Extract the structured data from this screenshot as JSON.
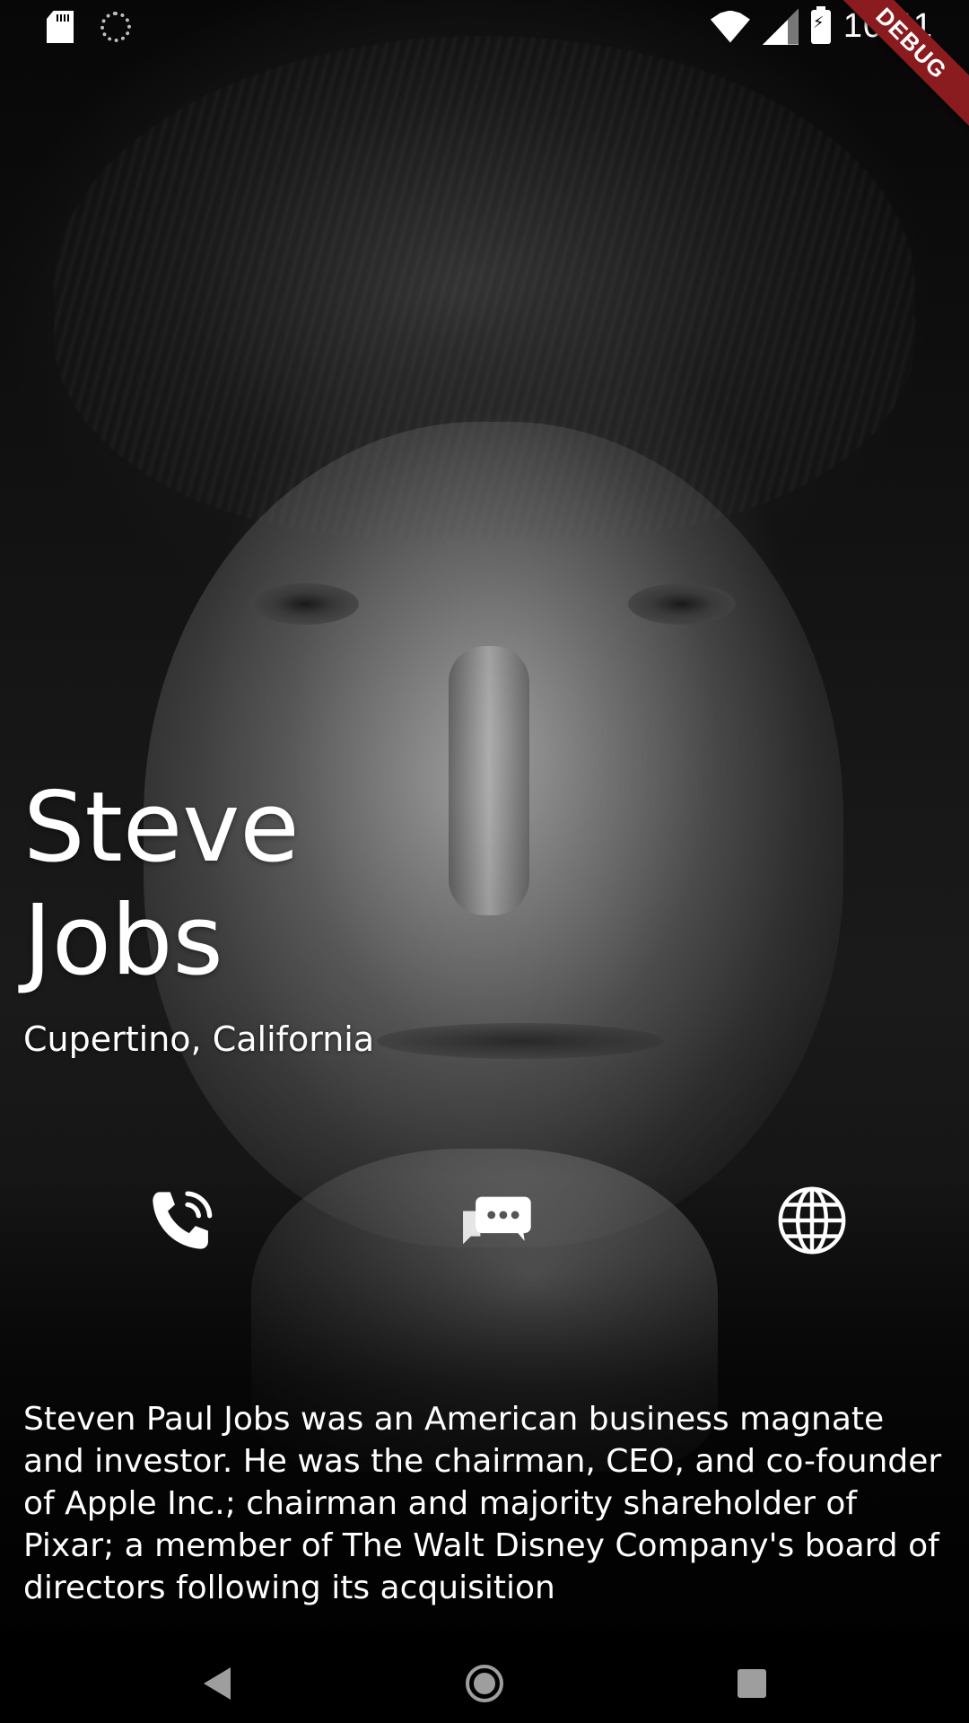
{
  "status_bar": {
    "time": "10:41",
    "left_icons": [
      "sd-card-icon",
      "sync-icon"
    ],
    "right_icons": [
      "wifi-icon",
      "signal-icon",
      "battery-charging-icon"
    ],
    "debug_banner": "DEBUG"
  },
  "profile": {
    "first_name": "Steve",
    "last_name": "Jobs",
    "location": "Cupertino, California",
    "bio": "Steven Paul Jobs was an American business magnate and investor. He was the chairman, CEO, and co-founder of Apple Inc.; chairman and majority shareholder of Pixar; a member of The Walt Disney Company's board of directors following its acquisition"
  },
  "actions": [
    {
      "name": "call",
      "icon": "phone-icon"
    },
    {
      "name": "message",
      "icon": "chat-bubbles-icon"
    },
    {
      "name": "website",
      "icon": "globe-icon"
    }
  ],
  "nav_bar": {
    "buttons": [
      "back",
      "home",
      "recents"
    ]
  },
  "colors": {
    "background": "#000000",
    "text": "#ffffff",
    "debug_ribbon": "#8a1c20",
    "nav_icons": "#9e9e9e"
  }
}
